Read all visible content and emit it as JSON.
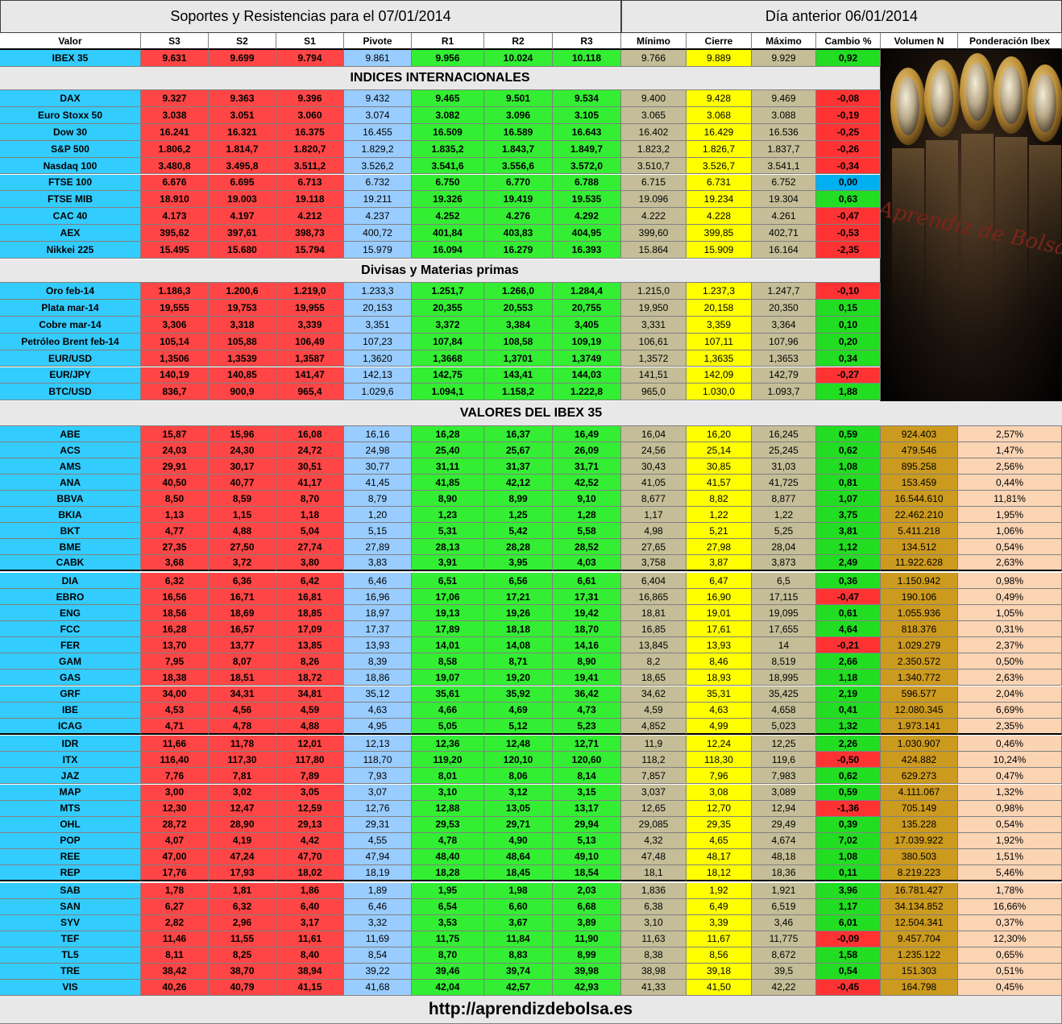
{
  "title_left": "Soportes y Resistencias para el  07/01/2014",
  "title_right": "Día anterior 06/01/2014",
  "headers": [
    "Valor",
    "S3",
    "S2",
    "S1",
    "Pivote",
    "R1",
    "R2",
    "R3",
    "Mínimo",
    "Cierre",
    "Máximo",
    "Cambio %",
    "Volumen N",
    "Ponderación Ibex"
  ],
  "ibex": [
    "IBEX 35",
    "9.631",
    "9.699",
    "9.794",
    "9.861",
    "9.956",
    "10.024",
    "10.118",
    "9.766",
    "9.889",
    "9.929",
    "0,92"
  ],
  "section_intl": "INDICES INTERNACIONALES",
  "intl": [
    [
      "DAX",
      "9.327",
      "9.363",
      "9.396",
      "9.432",
      "9.465",
      "9.501",
      "9.534",
      "9.400",
      "9.428",
      "9.469",
      "-0,08"
    ],
    [
      "Euro Stoxx 50",
      "3.038",
      "3.051",
      "3.060",
      "3.074",
      "3.082",
      "3.096",
      "3.105",
      "3.065",
      "3.068",
      "3.088",
      "-0,19"
    ],
    [
      "Dow 30",
      "16.241",
      "16.321",
      "16.375",
      "16.455",
      "16.509",
      "16.589",
      "16.643",
      "16.402",
      "16.429",
      "16.536",
      "-0,25"
    ],
    [
      "S&P 500",
      "1.806,2",
      "1.814,7",
      "1.820,7",
      "1.829,2",
      "1.835,2",
      "1.843,7",
      "1.849,7",
      "1.823,2",
      "1.826,7",
      "1.837,7",
      "-0,26"
    ],
    [
      "Nasdaq 100",
      "3.480,8",
      "3.495,8",
      "3.511,2",
      "3.526,2",
      "3.541,6",
      "3.556,6",
      "3.572,0",
      "3.510,7",
      "3.526,7",
      "3.541,1",
      "-0,34"
    ],
    [
      "FTSE 100",
      "6.676",
      "6.695",
      "6.713",
      "6.732",
      "6.750",
      "6.770",
      "6.788",
      "6.715",
      "6.731",
      "6.752",
      "0,00"
    ],
    [
      "FTSE MIB",
      "18.910",
      "19.003",
      "19.118",
      "19.211",
      "19.326",
      "19.419",
      "19.535",
      "19.096",
      "19.234",
      "19.304",
      "0,63"
    ],
    [
      "CAC 40",
      "4.173",
      "4.197",
      "4.212",
      "4.237",
      "4.252",
      "4.276",
      "4.292",
      "4.222",
      "4.228",
      "4.261",
      "-0,47"
    ],
    [
      "AEX",
      "395,62",
      "397,61",
      "398,73",
      "400,72",
      "401,84",
      "403,83",
      "404,95",
      "399,60",
      "399,85",
      "402,71",
      "-0,53"
    ],
    [
      "Nikkei 225",
      "15.495",
      "15.680",
      "15.794",
      "15.979",
      "16.094",
      "16.279",
      "16.393",
      "15.864",
      "15.909",
      "16.164",
      "-2,35"
    ]
  ],
  "section_fx": "Divisas y Materias primas",
  "fx": [
    [
      "Oro feb-14",
      "1.186,3",
      "1.200,6",
      "1.219,0",
      "1.233,3",
      "1.251,7",
      "1.266,0",
      "1.284,4",
      "1.215,0",
      "1.237,3",
      "1.247,7",
      "-0,10"
    ],
    [
      "Plata mar-14",
      "19,555",
      "19,753",
      "19,955",
      "20,153",
      "20,355",
      "20,553",
      "20,755",
      "19,950",
      "20,158",
      "20,350",
      "0,15"
    ],
    [
      "Cobre mar-14",
      "3,306",
      "3,318",
      "3,339",
      "3,351",
      "3,372",
      "3,384",
      "3,405",
      "3,331",
      "3,359",
      "3,364",
      "0,10"
    ],
    [
      "Petróleo Brent feb-14",
      "105,14",
      "105,88",
      "106,49",
      "107,23",
      "107,84",
      "108,58",
      "109,19",
      "106,61",
      "107,11",
      "107,96",
      "0,20"
    ],
    [
      "EUR/USD",
      "1,3506",
      "1,3539",
      "1,3587",
      "1,3620",
      "1,3668",
      "1,3701",
      "1,3749",
      "1,3572",
      "1,3635",
      "1,3653",
      "0,34"
    ],
    [
      "EUR/JPY",
      "140,19",
      "140,85",
      "141,47",
      "142,13",
      "142,75",
      "143,41",
      "144,03",
      "141,51",
      "142,09",
      "142,79",
      "-0,27"
    ],
    [
      "BTC/USD",
      "836,7",
      "900,9",
      "965,4",
      "1.029,6",
      "1.094,1",
      "1.158,2",
      "1.222,8",
      "965,0",
      "1.030,0",
      "1.093,7",
      "1,88"
    ]
  ],
  "section_ibex": "VALORES DEL IBEX 35",
  "stocks": [
    [
      "ABE",
      "15,87",
      "15,96",
      "16,08",
      "16,16",
      "16,28",
      "16,37",
      "16,49",
      "16,04",
      "16,20",
      "16,245",
      "0,59",
      "924.403",
      "2,57%"
    ],
    [
      "ACS",
      "24,03",
      "24,30",
      "24,72",
      "24,98",
      "25,40",
      "25,67",
      "26,09",
      "24,56",
      "25,14",
      "25,245",
      "0,62",
      "479.546",
      "1,47%"
    ],
    [
      "AMS",
      "29,91",
      "30,17",
      "30,51",
      "30,77",
      "31,11",
      "31,37",
      "31,71",
      "30,43",
      "30,85",
      "31,03",
      "1,08",
      "895.258",
      "2,56%"
    ],
    [
      "ANA",
      "40,50",
      "40,77",
      "41,17",
      "41,45",
      "41,85",
      "42,12",
      "42,52",
      "41,05",
      "41,57",
      "41,725",
      "0,81",
      "153.459",
      "0,44%"
    ],
    [
      "BBVA",
      "8,50",
      "8,59",
      "8,70",
      "8,79",
      "8,90",
      "8,99",
      "9,10",
      "8,677",
      "8,82",
      "8,877",
      "1,07",
      "16.544.610",
      "11,81%"
    ],
    [
      "BKIA",
      "1,13",
      "1,15",
      "1,18",
      "1,20",
      "1,23",
      "1,25",
      "1,28",
      "1,17",
      "1,22",
      "1,22",
      "3,75",
      "22.462.210",
      "1,95%"
    ],
    [
      "BKT",
      "4,77",
      "4,88",
      "5,04",
      "5,15",
      "5,31",
      "5,42",
      "5,58",
      "4,98",
      "5,21",
      "5,25",
      "3,81",
      "5.411.218",
      "1,06%"
    ],
    [
      "BME",
      "27,35",
      "27,50",
      "27,74",
      "27,89",
      "28,13",
      "28,28",
      "28,52",
      "27,65",
      "27,98",
      "28,04",
      "1,12",
      "134.512",
      "0,54%"
    ],
    [
      "CABK",
      "3,68",
      "3,72",
      "3,80",
      "3,83",
      "3,91",
      "3,95",
      "4,03",
      "3,758",
      "3,87",
      "3,873",
      "2,49",
      "11.922.628",
      "2,63%"
    ],
    [
      "DIA",
      "6,32",
      "6,36",
      "6,42",
      "6,46",
      "6,51",
      "6,56",
      "6,61",
      "6,404",
      "6,47",
      "6,5",
      "0,36",
      "1.150.942",
      "0,98%"
    ],
    [
      "EBRO",
      "16,56",
      "16,71",
      "16,81",
      "16,96",
      "17,06",
      "17,21",
      "17,31",
      "16,865",
      "16,90",
      "17,115",
      "-0,47",
      "190.106",
      "0,49%"
    ],
    [
      "ENG",
      "18,56",
      "18,69",
      "18,85",
      "18,97",
      "19,13",
      "19,26",
      "19,42",
      "18,81",
      "19,01",
      "19,095",
      "0,61",
      "1.055.936",
      "1,05%"
    ],
    [
      "FCC",
      "16,28",
      "16,57",
      "17,09",
      "17,37",
      "17,89",
      "18,18",
      "18,70",
      "16,85",
      "17,61",
      "17,655",
      "4,64",
      "818.376",
      "0,31%"
    ],
    [
      "FER",
      "13,70",
      "13,77",
      "13,85",
      "13,93",
      "14,01",
      "14,08",
      "14,16",
      "13,845",
      "13,93",
      "14",
      "-0,21",
      "1.029.279",
      "2,37%"
    ],
    [
      "GAM",
      "7,95",
      "8,07",
      "8,26",
      "8,39",
      "8,58",
      "8,71",
      "8,90",
      "8,2",
      "8,46",
      "8,519",
      "2,66",
      "2.350.572",
      "0,50%"
    ],
    [
      "GAS",
      "18,38",
      "18,51",
      "18,72",
      "18,86",
      "19,07",
      "19,20",
      "19,41",
      "18,65",
      "18,93",
      "18,995",
      "1,18",
      "1.340.772",
      "2,63%"
    ],
    [
      "GRF",
      "34,00",
      "34,31",
      "34,81",
      "35,12",
      "35,61",
      "35,92",
      "36,42",
      "34,62",
      "35,31",
      "35,425",
      "2,19",
      "596.577",
      "2,04%"
    ],
    [
      "IBE",
      "4,53",
      "4,56",
      "4,59",
      "4,63",
      "4,66",
      "4,69",
      "4,73",
      "4,59",
      "4,63",
      "4,658",
      "0,41",
      "12.080.345",
      "6,69%"
    ],
    [
      "ICAG",
      "4,71",
      "4,78",
      "4,88",
      "4,95",
      "5,05",
      "5,12",
      "5,23",
      "4,852",
      "4,99",
      "5,023",
      "1,32",
      "1.973.141",
      "2,35%"
    ],
    [
      "IDR",
      "11,66",
      "11,78",
      "12,01",
      "12,13",
      "12,36",
      "12,48",
      "12,71",
      "11,9",
      "12,24",
      "12,25",
      "2,26",
      "1.030.907",
      "0,46%"
    ],
    [
      "ITX",
      "116,40",
      "117,30",
      "117,80",
      "118,70",
      "119,20",
      "120,10",
      "120,60",
      "118,2",
      "118,30",
      "119,6",
      "-0,50",
      "424.882",
      "10,24%"
    ],
    [
      "JAZ",
      "7,76",
      "7,81",
      "7,89",
      "7,93",
      "8,01",
      "8,06",
      "8,14",
      "7,857",
      "7,96",
      "7,983",
      "0,62",
      "629.273",
      "0,47%"
    ],
    [
      "MAP",
      "3,00",
      "3,02",
      "3,05",
      "3,07",
      "3,10",
      "3,12",
      "3,15",
      "3,037",
      "3,08",
      "3,089",
      "0,59",
      "4.111.067",
      "1,32%"
    ],
    [
      "MTS",
      "12,30",
      "12,47",
      "12,59",
      "12,76",
      "12,88",
      "13,05",
      "13,17",
      "12,65",
      "12,70",
      "12,94",
      "-1,36",
      "705.149",
      "0,98%"
    ],
    [
      "OHL",
      "28,72",
      "28,90",
      "29,13",
      "29,31",
      "29,53",
      "29,71",
      "29,94",
      "29,085",
      "29,35",
      "29,49",
      "0,39",
      "135.228",
      "0,54%"
    ],
    [
      "POP",
      "4,07",
      "4,19",
      "4,42",
      "4,55",
      "4,78",
      "4,90",
      "5,13",
      "4,32",
      "4,65",
      "4,674",
      "7,02",
      "17.039.922",
      "1,92%"
    ],
    [
      "REE",
      "47,00",
      "47,24",
      "47,70",
      "47,94",
      "48,40",
      "48,64",
      "49,10",
      "47,48",
      "48,17",
      "48,18",
      "1,08",
      "380.503",
      "1,51%"
    ],
    [
      "REP",
      "17,76",
      "17,93",
      "18,02",
      "18,19",
      "18,28",
      "18,45",
      "18,54",
      "18,1",
      "18,12",
      "18,36",
      "0,11",
      "8.219.223",
      "5,46%"
    ],
    [
      "SAB",
      "1,78",
      "1,81",
      "1,86",
      "1,89",
      "1,95",
      "1,98",
      "2,03",
      "1,836",
      "1,92",
      "1,921",
      "3,96",
      "16.781.427",
      "1,78%"
    ],
    [
      "SAN",
      "6,27",
      "6,32",
      "6,40",
      "6,46",
      "6,54",
      "6,60",
      "6,68",
      "6,38",
      "6,49",
      "6,519",
      "1,17",
      "34.134.852",
      "16,66%"
    ],
    [
      "SYV",
      "2,82",
      "2,96",
      "3,17",
      "3,32",
      "3,53",
      "3,67",
      "3,89",
      "3,10",
      "3,39",
      "3,46",
      "6,01",
      "12.504.341",
      "0,37%"
    ],
    [
      "TEF",
      "11,46",
      "11,55",
      "11,61",
      "11,69",
      "11,75",
      "11,84",
      "11,90",
      "11,63",
      "11,67",
      "11,775",
      "-0,09",
      "9.457.704",
      "12,30%"
    ],
    [
      "TL5",
      "8,11",
      "8,25",
      "8,40",
      "8,54",
      "8,70",
      "8,83",
      "8,99",
      "8,38",
      "8,56",
      "8,672",
      "1,58",
      "1.235.122",
      "0,65%"
    ],
    [
      "TRE",
      "38,42",
      "38,70",
      "38,94",
      "39,22",
      "39,46",
      "39,74",
      "39,98",
      "38,98",
      "39,18",
      "39,5",
      "0,54",
      "151.303",
      "0,51%"
    ],
    [
      "VIS",
      "40,26",
      "40,79",
      "41,15",
      "41,68",
      "42,04",
      "42,57",
      "42,93",
      "41,33",
      "41,50",
      "42,22",
      "-0,45",
      "164.798",
      "0,45%"
    ]
  ],
  "image_text": "Aprendiz de Bolsa",
  "footer": "http://aprendizdebolsa.es"
}
